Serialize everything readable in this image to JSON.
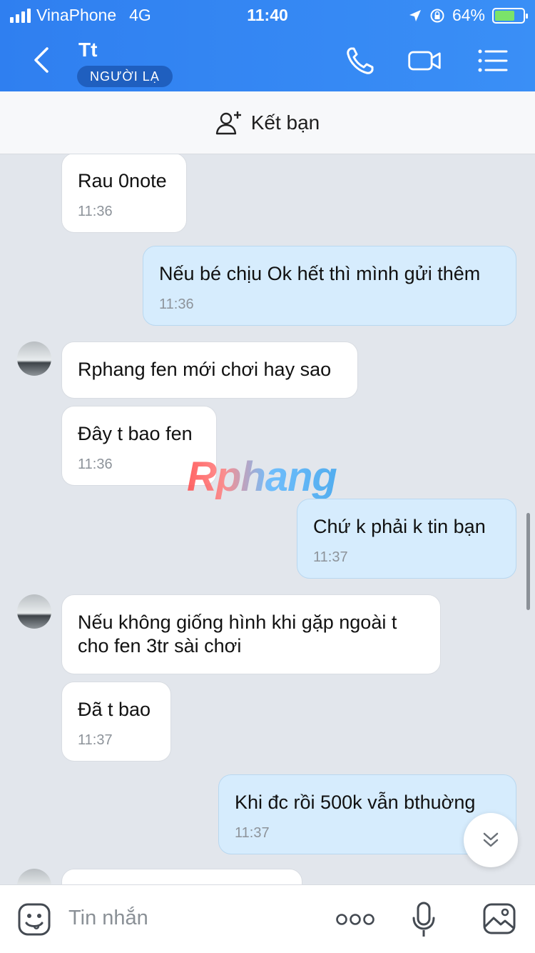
{
  "status": {
    "carrier": "VinaPhone",
    "network": "4G",
    "time": "11:40",
    "battery": "64%"
  },
  "header": {
    "name": "Tt",
    "badge": "NGƯỜI LẠ"
  },
  "friend_bar": {
    "label": "Kết bạn"
  },
  "watermark": "Rphang",
  "messages": [
    {
      "text": "Rau 0note",
      "time": "11:36"
    },
    {
      "text": "Nếu bé chịu Ok hết thì mình gửi thêm",
      "time": "11:36"
    },
    {
      "text": "Rphang fen mới chơi hay sao"
    },
    {
      "text": "Đây t bao fen",
      "time": "11:36"
    },
    {
      "text": "Chứ k phải k tin bạn",
      "time": "11:37"
    },
    {
      "text": "Nếu không giống hình khi gặp ngoài t cho fen 3tr sài chơi"
    },
    {
      "text": "Đã t bao",
      "time": "11:37"
    },
    {
      "text": "Khi đc rồi 500k vẫn bthuờng",
      "time": "11:37"
    }
  ],
  "input": {
    "placeholder": "Tin nhắn"
  },
  "colors": {
    "header": "#3385f2",
    "bubble_out": "#d6ecfd",
    "bubble_in": "#ffffff",
    "chat_bg": "#e2e6ec"
  }
}
